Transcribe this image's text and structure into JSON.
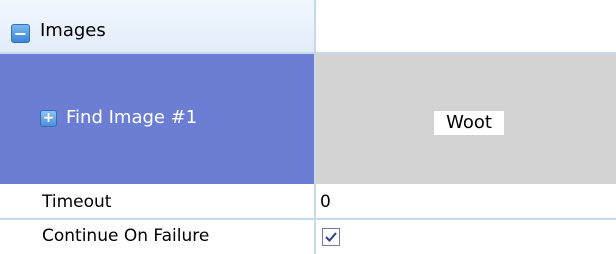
{
  "category": {
    "label": "Images",
    "expander_symbol": "−"
  },
  "image_item": {
    "label": "Find Image #1",
    "expander_symbol": "+",
    "value": "Woot"
  },
  "properties": {
    "timeout": {
      "label": "Timeout",
      "value": "0"
    },
    "continue_on_failure": {
      "label": "Continue On Failure",
      "checked": true
    }
  },
  "colors": {
    "selected_row": "#6b7ed3",
    "image_preview_bg": "#d3d3d3",
    "grid_line": "#c9d9ec"
  }
}
